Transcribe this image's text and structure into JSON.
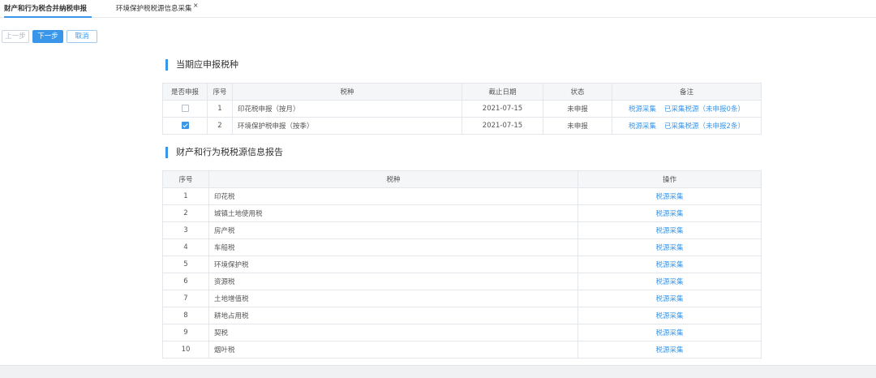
{
  "tabs": [
    {
      "label": "财产和行为税合并纳税申报"
    },
    {
      "label": "环境保护税税源信息采集",
      "close": "×"
    }
  ],
  "toolbar": {
    "prev_label": "上一步",
    "next_label": "下一步",
    "cancel_label": "取消"
  },
  "section1": {
    "title": "当期应申报税种",
    "headers": [
      "是否申报",
      "序号",
      "税种",
      "截止日期",
      "状态",
      "备注"
    ],
    "rows": [
      {
        "checked": false,
        "no": "1",
        "tax": "印花税申报（按月）",
        "deadline": "2021-07-15",
        "status": "未申报",
        "link1": "税源采集",
        "link2": "已采集税源（未申报0条）"
      },
      {
        "checked": true,
        "no": "2",
        "tax": "环境保护税申报（按季）",
        "deadline": "2021-07-15",
        "status": "未申报",
        "link1": "税源采集",
        "link2": "已采集税源（未申报2条）"
      }
    ]
  },
  "section2": {
    "title": "财产和行为税税源信息报告",
    "headers": [
      "序号",
      "税种",
      "操作"
    ],
    "rows": [
      {
        "no": "1",
        "tax": "印花税",
        "action": "税源采集"
      },
      {
        "no": "2",
        "tax": "城镇土地使用税",
        "action": "税源采集"
      },
      {
        "no": "3",
        "tax": "房产税",
        "action": "税源采集"
      },
      {
        "no": "4",
        "tax": "车船税",
        "action": "税源采集"
      },
      {
        "no": "5",
        "tax": "环境保护税",
        "action": "税源采集"
      },
      {
        "no": "6",
        "tax": "资源税",
        "action": "税源采集"
      },
      {
        "no": "7",
        "tax": "土地增值税",
        "action": "税源采集"
      },
      {
        "no": "8",
        "tax": "耕地占用税",
        "action": "税源采集"
      },
      {
        "no": "9",
        "tax": "契税",
        "action": "税源采集"
      },
      {
        "no": "10",
        "tax": "烟叶税",
        "action": "税源采集"
      }
    ]
  },
  "colors": {
    "accent": "#3a96e8",
    "border": "#e3e6ea",
    "header_bg": "#f5f6f8"
  },
  "icons": {
    "tab_close": "close-icon",
    "checkbox": "checkbox"
  }
}
